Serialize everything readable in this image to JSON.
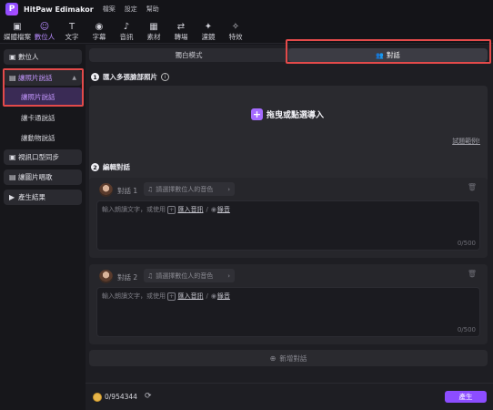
{
  "app": {
    "title": "HitPaw Edimakor",
    "logo_glyph": "P"
  },
  "menu": [
    "檔案",
    "設定",
    "幫助"
  ],
  "toolbar": [
    {
      "icon": "media-folder-icon",
      "glyph": "▣",
      "label": "媒體檔案",
      "active": false
    },
    {
      "icon": "digital-human-icon",
      "glyph": "☺",
      "label": "數位人",
      "active": true
    },
    {
      "icon": "text-icon",
      "glyph": "T",
      "label": "文字",
      "active": false
    },
    {
      "icon": "subtitle-icon",
      "glyph": "◉",
      "label": "字幕",
      "active": false
    },
    {
      "icon": "audio-icon",
      "glyph": "♪",
      "label": "音訊",
      "active": false
    },
    {
      "icon": "asset-icon",
      "glyph": "▦",
      "label": "素材",
      "active": false
    },
    {
      "icon": "transition-icon",
      "glyph": "⇄",
      "label": "轉場",
      "active": false
    },
    {
      "icon": "filter-icon",
      "glyph": "✦",
      "label": "濾鏡",
      "active": false
    },
    {
      "icon": "effects-icon",
      "glyph": "✧",
      "label": "特效",
      "active": false
    }
  ],
  "sidebar": {
    "digital_human": "數位人",
    "photo_talk": "讓照片說話",
    "photo_talk_sub": "讓照片說話",
    "card_talk": "讓卡通說話",
    "animal_talk": "讓動物說話",
    "lip_sync": "視訊口型同步",
    "image_sing": "讓圖片唱歌",
    "results": "產生結果"
  },
  "modes": {
    "mono": "獨白模式",
    "dialog": "對話"
  },
  "step1": {
    "num": "1",
    "title": "匯入多張臉部照片",
    "info": "i"
  },
  "dropzone": {
    "plus": "+",
    "label": "拖曳或點選導入",
    "example": "試題範例!"
  },
  "step2": {
    "num": "2",
    "title": "編輯對話"
  },
  "dialogs": [
    {
      "name": "對話 1",
      "voice_placeholder": "請選擇數位人的音色",
      "hint": "輸入朗讀文字，或使用",
      "import_audio": "匯入音訊",
      "slash": "/",
      "record": "錄音",
      "counter": "0/500"
    },
    {
      "name": "對話 2",
      "voice_placeholder": "請選擇數位人的音色",
      "hint": "輸入朗讀文字，或使用",
      "import_audio": "匯入音訊",
      "slash": "/",
      "record": "錄音",
      "counter": "0/500"
    }
  ],
  "add_dialog": "新增對話",
  "bottom": {
    "credits": "0/954344",
    "generate": "產生"
  }
}
